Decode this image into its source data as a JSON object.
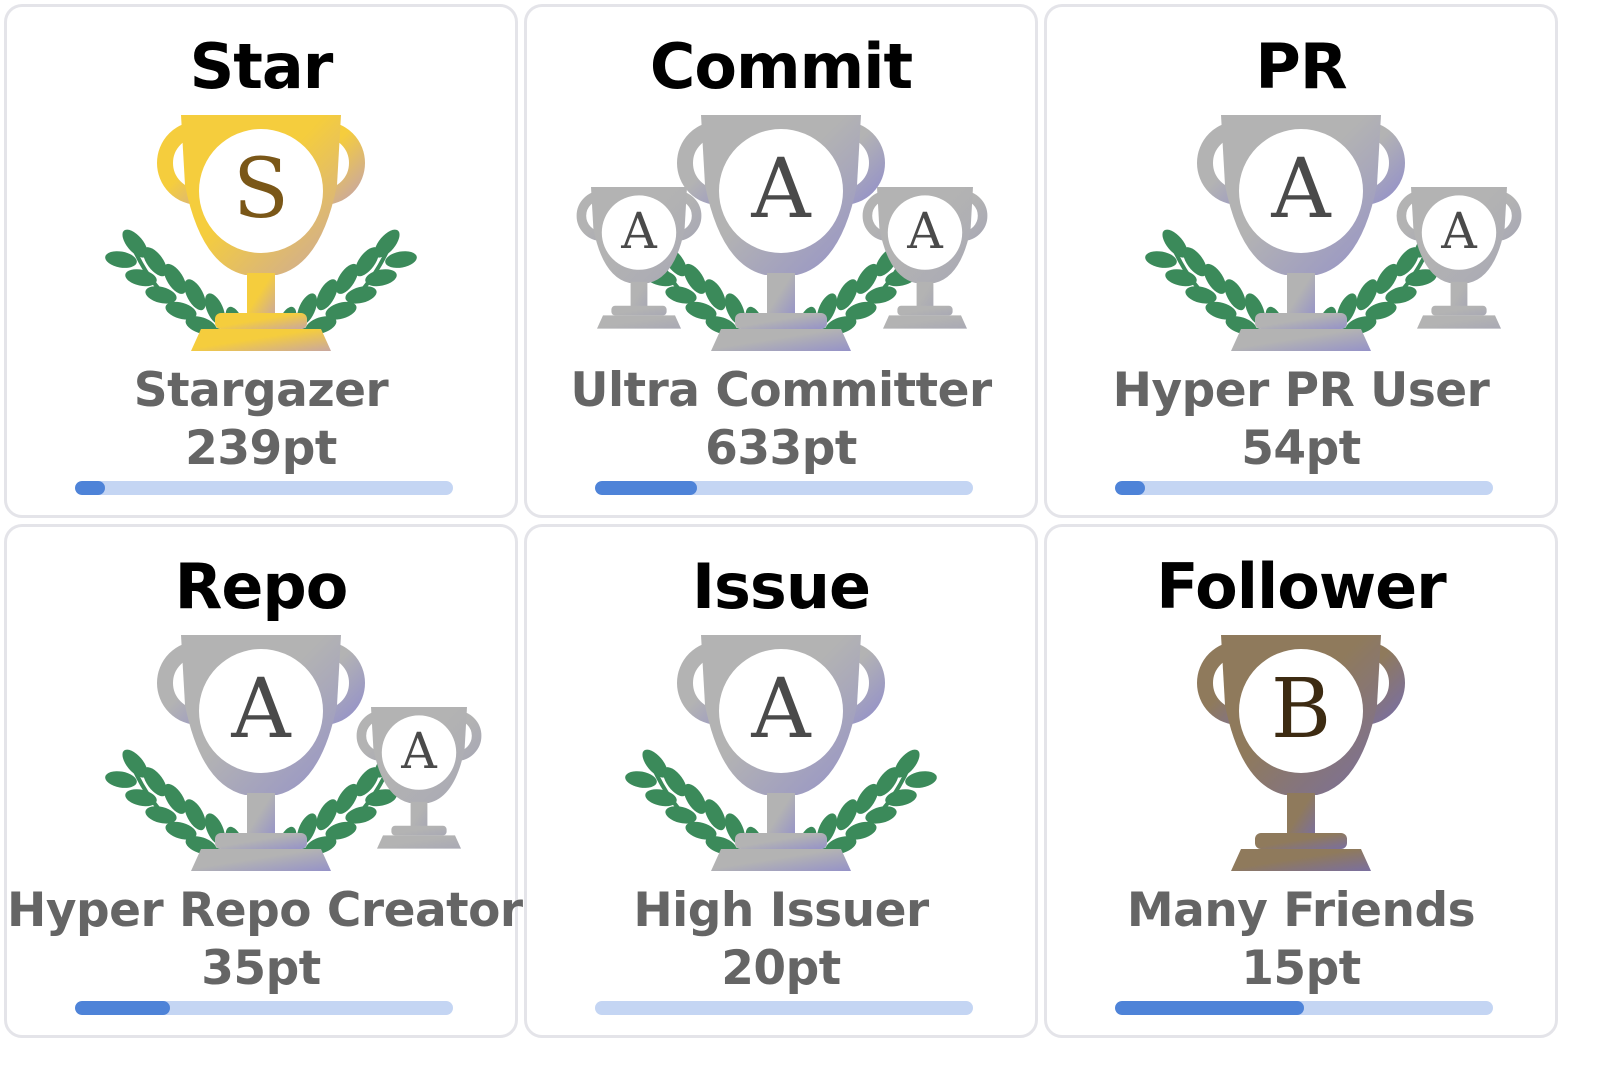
{
  "colors": {
    "card_border": "#e4e4e9",
    "title_text": "#000000",
    "label_text": "#656565",
    "progress_track": "#c4d5f3",
    "progress_fill": "#4e83d8",
    "laurel_green": "#3b8a5a",
    "gold": "#f5cd3d",
    "silver": "#b3b3b3",
    "bronze": "#8f7a5c",
    "ribbon_purple": "#9592c8"
  },
  "cards": [
    {
      "category": "Star",
      "rank": "S",
      "title": "Stargazer",
      "points": "239pt",
      "progress": 0.08,
      "trophy_style": "gold",
      "mini_trophies": []
    },
    {
      "category": "Commit",
      "rank": "A",
      "title": "Ultra Committer",
      "points": "633pt",
      "progress": 0.27,
      "trophy_style": "silver",
      "mini_trophies": [
        "A",
        "A"
      ]
    },
    {
      "category": "PR",
      "rank": "A",
      "title": "Hyper PR User",
      "points": "54pt",
      "progress": 0.08,
      "trophy_style": "silver",
      "mini_trophies": [
        "A"
      ]
    },
    {
      "category": "Repo",
      "rank": "A",
      "title": "Hyper Repo Creator",
      "points": "35pt",
      "progress": 0.25,
      "trophy_style": "silver",
      "mini_trophies": [
        "A"
      ]
    },
    {
      "category": "Issue",
      "rank": "A",
      "title": "High Issuer",
      "points": "20pt",
      "progress": 0.0,
      "trophy_style": "silver",
      "mini_trophies": []
    },
    {
      "category": "Follower",
      "rank": "B",
      "title": "Many Friends",
      "points": "15pt",
      "progress": 0.5,
      "trophy_style": "bronze",
      "mini_trophies": []
    }
  ]
}
